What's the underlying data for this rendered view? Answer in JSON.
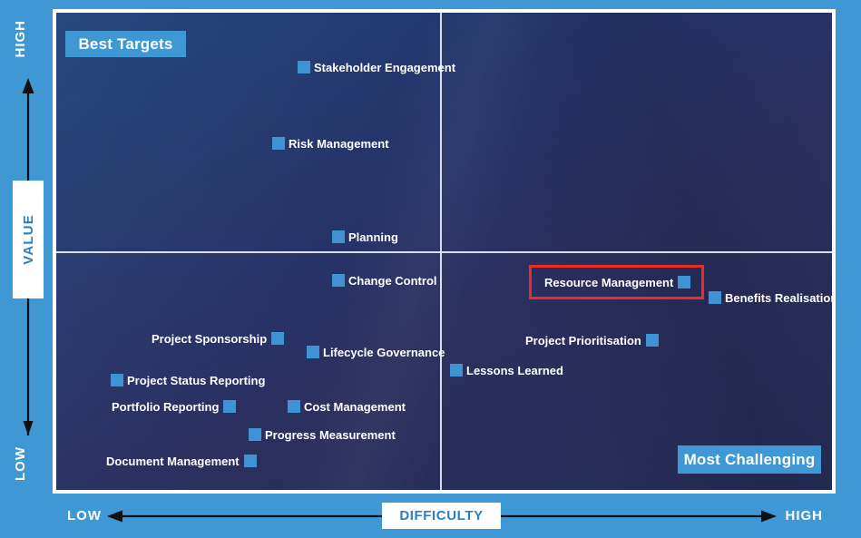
{
  "chart_data": {
    "type": "scatter",
    "title": "",
    "xlabel": "DIFFICULTY",
    "ylabel": "VALUE",
    "x_low_label": "LOW",
    "x_high_label": "HIGH",
    "y_low_label": "LOW",
    "y_high_label": "HIGH",
    "xlim": [
      0,
      100
    ],
    "ylim": [
      0,
      100
    ],
    "grid": false,
    "quadrant_divider_x": 42,
    "quadrant_divider_y": 50,
    "annotations": [
      {
        "text": "Best Targets",
        "quadrant": "top-left"
      },
      {
        "text": "Most Challenging",
        "quadrant": "bottom-right"
      }
    ],
    "highlighted_point": "Resource Management",
    "points": [
      {
        "label": "Stakeholder Engagement",
        "x": 32,
        "y": 90,
        "marker_side": "left"
      },
      {
        "label": "Risk Management",
        "x": 28,
        "y": 74,
        "marker_side": "left"
      },
      {
        "label": "Planning",
        "x": 37,
        "y": 54,
        "marker_side": "left"
      },
      {
        "label": "Change Control",
        "x": 37,
        "y": 45,
        "marker_side": "left"
      },
      {
        "label": "Resource Management",
        "x": 79,
        "y": 42,
        "marker_side": "right"
      },
      {
        "label": "Benefits Realisation",
        "x": 85,
        "y": 40,
        "marker_side": "left"
      },
      {
        "label": "Project Sponsorship",
        "x": 27,
        "y": 33,
        "marker_side": "right"
      },
      {
        "label": "Project Prioritisation",
        "x": 75,
        "y": 32,
        "marker_side": "right"
      },
      {
        "label": "Lifecycle Governance",
        "x": 36,
        "y": 29,
        "marker_side": "left"
      },
      {
        "label": "Lessons Learned",
        "x": 51,
        "y": 26,
        "marker_side": "left"
      },
      {
        "label": "Project Status Reporting",
        "x": 13,
        "y": 24,
        "marker_side": "left"
      },
      {
        "label": "Portfolio Reporting",
        "x": 23,
        "y": 19,
        "marker_side": "right"
      },
      {
        "label": "Cost Management",
        "x": 34,
        "y": 19,
        "marker_side": "left"
      },
      {
        "label": "Progress Measurement",
        "x": 29,
        "y": 13,
        "marker_side": "left"
      },
      {
        "label": "Document Management",
        "x": 25,
        "y": 6,
        "marker_side": "right"
      }
    ]
  },
  "axes": {
    "value": {
      "label": "VALUE",
      "high": "HIGH",
      "low": "LOW"
    },
    "difficulty": {
      "label": "DIFFICULTY",
      "low": "LOW",
      "high": "HIGH"
    }
  },
  "badges": {
    "best_targets": "Best Targets",
    "most_challenging": "Most Challenging"
  },
  "colors": {
    "page_background": "#3f97d4",
    "plot_background_dark": "#25356b",
    "plot_background_light": "#1d4076",
    "marker": "#3f93d3",
    "badge": "#3f97d4",
    "highlight_border": "#ee2b23",
    "axis_label_text": "#2d7fc1",
    "frame": "#ffffff",
    "divider": "#e9eef7"
  }
}
